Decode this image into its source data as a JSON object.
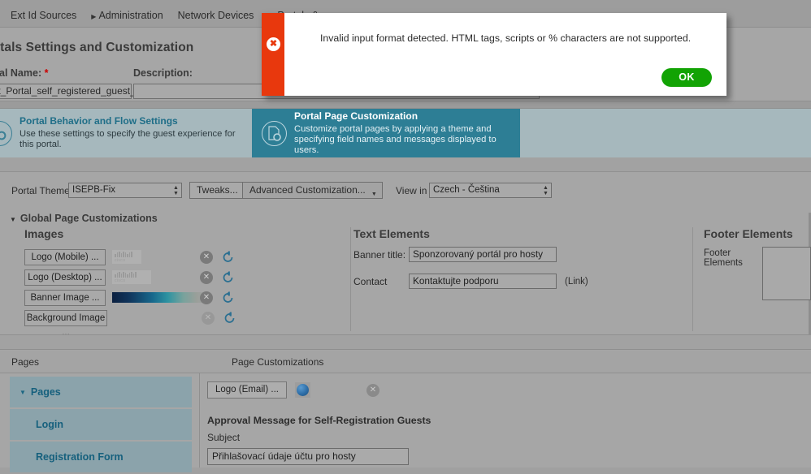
{
  "colors": {
    "accent_teal": "#2d7e95",
    "link_blue": "#16607d",
    "error_red": "#e8380d",
    "ok_green": "#12a304",
    "page_gray": "#a6a6a6"
  },
  "topnav": {
    "items": [
      {
        "label": "Ext Id Sources",
        "caret": "",
        "active": false,
        "faded": false
      },
      {
        "label": "Administration",
        "caret": "right",
        "active": false,
        "faded": false
      },
      {
        "label": "Network Devices",
        "caret": "",
        "active": false,
        "faded": false
      },
      {
        "label": "Portals &",
        "caret": "down",
        "active": true,
        "faded": false
      }
    ]
  },
  "header": {
    "page_title": "Portals Settings and Customization",
    "portal_name_label": "Portal Name:",
    "portal_name_required": "*",
    "portal_name_value": "uest_Portal_self_registered_guest_",
    "description_label": "Description:",
    "description_value": "",
    "description_placeholder": ""
  },
  "wizard": {
    "cards": [
      {
        "title": "Portal Behavior and Flow Settings",
        "desc": "Use these settings to specify the guest experience for this portal.",
        "icon": "flow-gear-icon",
        "selected": false
      },
      {
        "title": "Portal Page Customization",
        "desc": "Customize portal pages by applying a theme and specifying field names and messages displayed to users.",
        "icon": "page-gear-icon",
        "selected": true
      }
    ]
  },
  "toolbar": {
    "portal_theme_label": "Portal Theme",
    "portal_theme_value": "ISEPB-Fix",
    "tweaks_label": "Tweaks...",
    "advanced_label": "Advanced Customization...",
    "view_in_label": "View in",
    "view_in_value": "Czech - Čeština"
  },
  "global": {
    "section_label": "Global Page Customizations",
    "images": {
      "heading": "Images",
      "rows": [
        {
          "button": "Logo (Mobile) ...",
          "thumb": "cisco-logo-thumb",
          "clear_enabled": true
        },
        {
          "button": "Logo (Desktop) ...",
          "thumb": "cisco-logo-thumb-wide",
          "clear_enabled": true
        },
        {
          "button": "Banner Image ...",
          "thumb": "gradient-banner-thumb",
          "clear_enabled": true
        },
        {
          "button": "Background Image ...",
          "thumb": "",
          "clear_enabled": false
        }
      ],
      "clear_icon": "✕",
      "reset_icon": "reset-arrow-icon"
    },
    "text_elements": {
      "heading": "Text Elements",
      "banner_title_label": "Banner title:",
      "banner_title_value": "Sponzorovaný portál pro hosty",
      "contact_label": "Contact",
      "contact_value": "Kontaktujte podporu",
      "contact_note": "(Link)"
    },
    "footer_elements": {
      "heading": "Footer Elements",
      "label": "Footer Elements",
      "value": ""
    }
  },
  "lower": {
    "pages_header": "Pages",
    "customizations_header": "Page Customizations",
    "pages_tree": [
      {
        "label": "Pages",
        "level": "root",
        "expanded": true
      },
      {
        "label": "Login",
        "level": "child",
        "expanded": false
      },
      {
        "label": "Registration Form",
        "level": "child",
        "expanded": false
      }
    ],
    "logo_email_button": "Logo (Email) ...",
    "logo_email_thumb": "globe-icon-thumb",
    "logo_email_clear_icon": "✕",
    "approval_heading": "Approval Message for Self-Registration Guests",
    "subject_label": "Subject",
    "subject_value": "Přihlašovací údaje účtu pro hosty"
  },
  "modal": {
    "icon": "error-x-icon",
    "icon_glyph": "✖",
    "message": "Invalid input format detected. HTML tags, scripts or % characters are not supported.",
    "ok_label": "OK"
  }
}
